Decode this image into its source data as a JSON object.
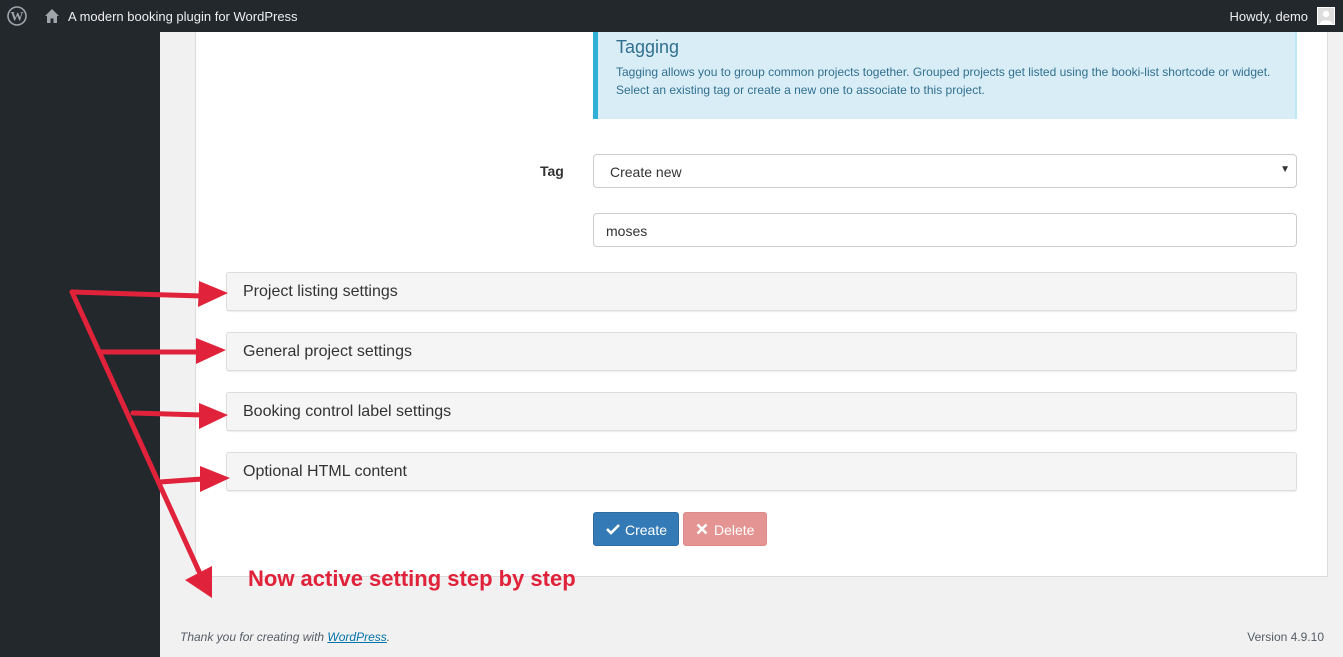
{
  "admin_bar": {
    "site_name": "A modern booking plugin for WordPress",
    "greeting": "Howdy, demo",
    "icons": [
      "wordpress-icon",
      "home-icon",
      "avatar"
    ]
  },
  "tagging": {
    "title": "Tagging",
    "description": "Tagging allows you to group common projects together. Grouped projects get listed using the booki-list shortcode or widget. Select an existing tag or create a new one to associate to this project."
  },
  "tag_field": {
    "label": "Tag",
    "selected": "Create new",
    "new_tag_value": "moses"
  },
  "sections": [
    {
      "label": "Project listing settings"
    },
    {
      "label": "General project settings"
    },
    {
      "label": "Booking control label settings"
    },
    {
      "label": "Optional HTML content"
    }
  ],
  "buttons": {
    "create": "Create",
    "delete": "Delete"
  },
  "annotation": {
    "text": "Now active setting step by step",
    "color": "#e0223a"
  },
  "footer": {
    "thanks_prefix": "Thank you for creating with ",
    "thanks_link": "WordPress",
    "thanks_suffix": ".",
    "version": "Version 4.9.10"
  },
  "colors": {
    "admin_bar": "#23282d",
    "primary_button": "#337ab7",
    "danger_button": "#e49492",
    "callout_bg": "#d9edf7",
    "callout_text": "#31708f"
  }
}
